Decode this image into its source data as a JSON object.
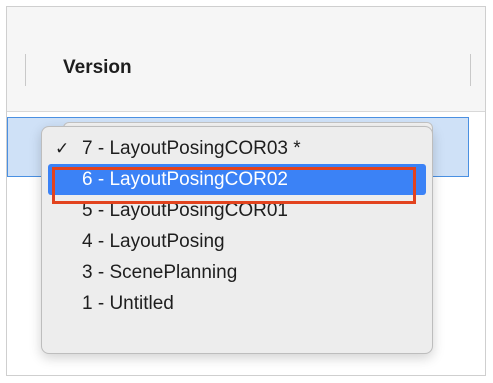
{
  "table": {
    "column_header": "Version"
  },
  "version_dropdown": {
    "options": [
      {
        "label": "7 - LayoutPosingCOR03 *",
        "checked": true
      },
      {
        "label": "6 - LayoutPosingCOR02",
        "highlighted": true
      },
      {
        "label": "5 - LayoutPosingCOR01"
      },
      {
        "label": "4 - LayoutPosing"
      },
      {
        "label": "3 - ScenePlanning"
      },
      {
        "label": "1 - Untitled"
      }
    ],
    "check_glyph": "✓"
  },
  "colors": {
    "highlight": "#3b82f6",
    "annotation_border": "#e2431e",
    "selected_row": "#cfe1f7"
  }
}
